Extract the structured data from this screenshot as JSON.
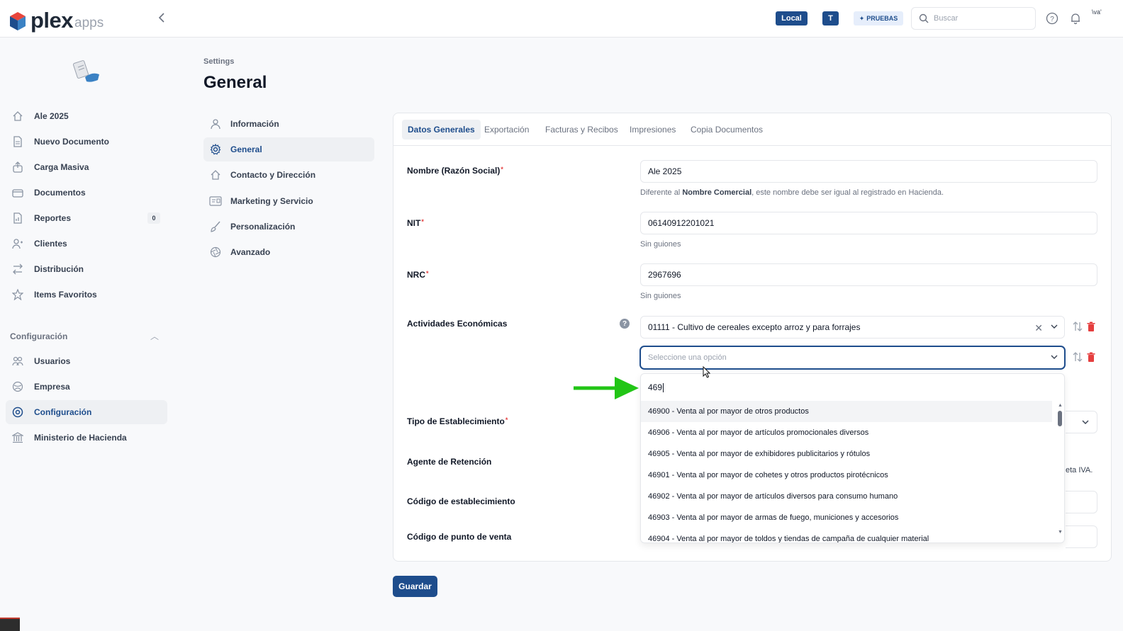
{
  "header": {
    "brand": "plex",
    "brand_sub": "apps",
    "badge_local": "Local",
    "badge_t": "T",
    "badge_pruebas": "PRUEBAS",
    "search_placeholder": "Buscar",
    "avatar_alt": "\\va'",
    "icons": [
      "plex-cube-logo",
      "chevron-left-icon",
      "search-icon",
      "help-icon",
      "bell-icon"
    ]
  },
  "sidebar": {
    "items": [
      {
        "label": "Ale 2025",
        "icon": "home-icon"
      },
      {
        "label": "Nuevo Documento",
        "icon": "document-icon"
      },
      {
        "label": "Carga Masiva",
        "icon": "upload-icon"
      },
      {
        "label": "Documentos",
        "icon": "folder-icon"
      },
      {
        "label": "Reportes",
        "icon": "report-icon",
        "count": "0"
      },
      {
        "label": "Clientes",
        "icon": "users-icon"
      },
      {
        "label": "Distribución",
        "icon": "swap-icon"
      },
      {
        "label": "Items Favoritos",
        "icon": "star-icon"
      }
    ],
    "section_title": "Configuración",
    "config_items": [
      {
        "label": "Usuarios",
        "icon": "people-icon"
      },
      {
        "label": "Empresa",
        "icon": "globe-icon"
      },
      {
        "label": "Configuración",
        "icon": "settings-icon",
        "active": true
      },
      {
        "label": "Ministerio de Hacienda",
        "icon": "bank-icon"
      }
    ]
  },
  "settings": {
    "breadcrumb": "Settings",
    "title": "General",
    "menu": [
      {
        "label": "Información",
        "icon": "user-icon"
      },
      {
        "label": "General",
        "icon": "gear-icon",
        "active": true
      },
      {
        "label": "Contacto y Dirección",
        "icon": "home-icon"
      },
      {
        "label": "Marketing y Servicio",
        "icon": "card-icon"
      },
      {
        "label": "Personalización",
        "icon": "brush-icon"
      },
      {
        "label": "Avanzado",
        "icon": "aperture-icon"
      }
    ]
  },
  "tabs": [
    "Datos Generales",
    "Exportación",
    "Facturas y Recibos",
    "Impresiones",
    "Copia Documentos"
  ],
  "form": {
    "nombre_label": "Nombre (Razón Social)",
    "nombre_value": "Ale 2025",
    "nombre_hint_pre": "Diferente al ",
    "nombre_hint_bold": "Nombre Comercial",
    "nombre_hint_post": ", este nombre debe ser igual al registrado en Hacienda.",
    "nit_label": "NIT",
    "nit_value": "06140912201021",
    "nit_hint": "Sin guiones",
    "nrc_label": "NRC",
    "nrc_value": "2967696",
    "nrc_hint": "Sin guiones",
    "actividades_label": "Actividades Económicas",
    "actividad_1": "01111 - Cultivo de cereales excepto arroz y para forrajes",
    "actividad_2_placeholder": "Seleccione una opción",
    "tipo_label": "Tipo de Establecimiento",
    "agente_label": "Agente de Retención",
    "agente_partial": "eta IVA.",
    "codigo_est_label": "Código de establecimiento",
    "codigo_pv_label": "Código de punto de venta",
    "required_mark": "*"
  },
  "dropdown": {
    "search_value": "469",
    "options": [
      "46900 - Venta al por mayor de otros productos",
      "46906 - Venta al por mayor de artículos promocionales diversos",
      "46905 - Venta al por mayor de exhibidores publicitarios y rótulos",
      "46901 - Venta al por mayor de cohetes y otros productos pirotécnicos",
      "46902 - Venta al por mayor de artículos diversos para consumo humano",
      "46903 - Venta al por mayor de armas de fuego, municiones y accesorios",
      "46904 - Venta al por mayor de toldos y tiendas de campaña de cualquier material"
    ]
  },
  "save_label": "Guardar",
  "colors": {
    "primary": "#1e4d8c",
    "danger": "#e53e3e",
    "arrow": "#22c516"
  }
}
